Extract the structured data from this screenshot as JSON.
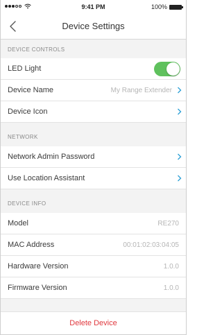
{
  "status_bar": {
    "time": "9:41 PM",
    "battery_percent": "100%",
    "signal_dots_filled": 3,
    "signal_dots_total": 5
  },
  "nav": {
    "back_icon": "chevron-left-icon",
    "title": "Device Settings"
  },
  "sections": {
    "device_controls": {
      "header": "DEVICE CONTROLS",
      "led_light": {
        "label": "LED Light",
        "on": true
      },
      "device_name": {
        "label": "Device Name",
        "value": "My Range Extender"
      },
      "device_icon": {
        "label": "Device Icon"
      }
    },
    "network": {
      "header": "NETWORK",
      "admin_password": {
        "label": "Network Admin Password"
      },
      "location_assistant": {
        "label": "Use Location Assistant"
      }
    },
    "device_info": {
      "header": "DEVICE INFO",
      "model": {
        "label": "Model",
        "value": "RE270"
      },
      "mac": {
        "label": "MAC Address",
        "value": "00:01:02:03:04:05"
      },
      "hardware": {
        "label": "Hardware Version",
        "value": "1.0.0"
      },
      "firmware": {
        "label": "Firmware Version",
        "value": "1.0.0"
      }
    }
  },
  "delete_label": "Delete Device",
  "colors": {
    "accent": "#2a9fd6",
    "toggle_on": "#5fc15d",
    "danger": "#e0383e"
  }
}
